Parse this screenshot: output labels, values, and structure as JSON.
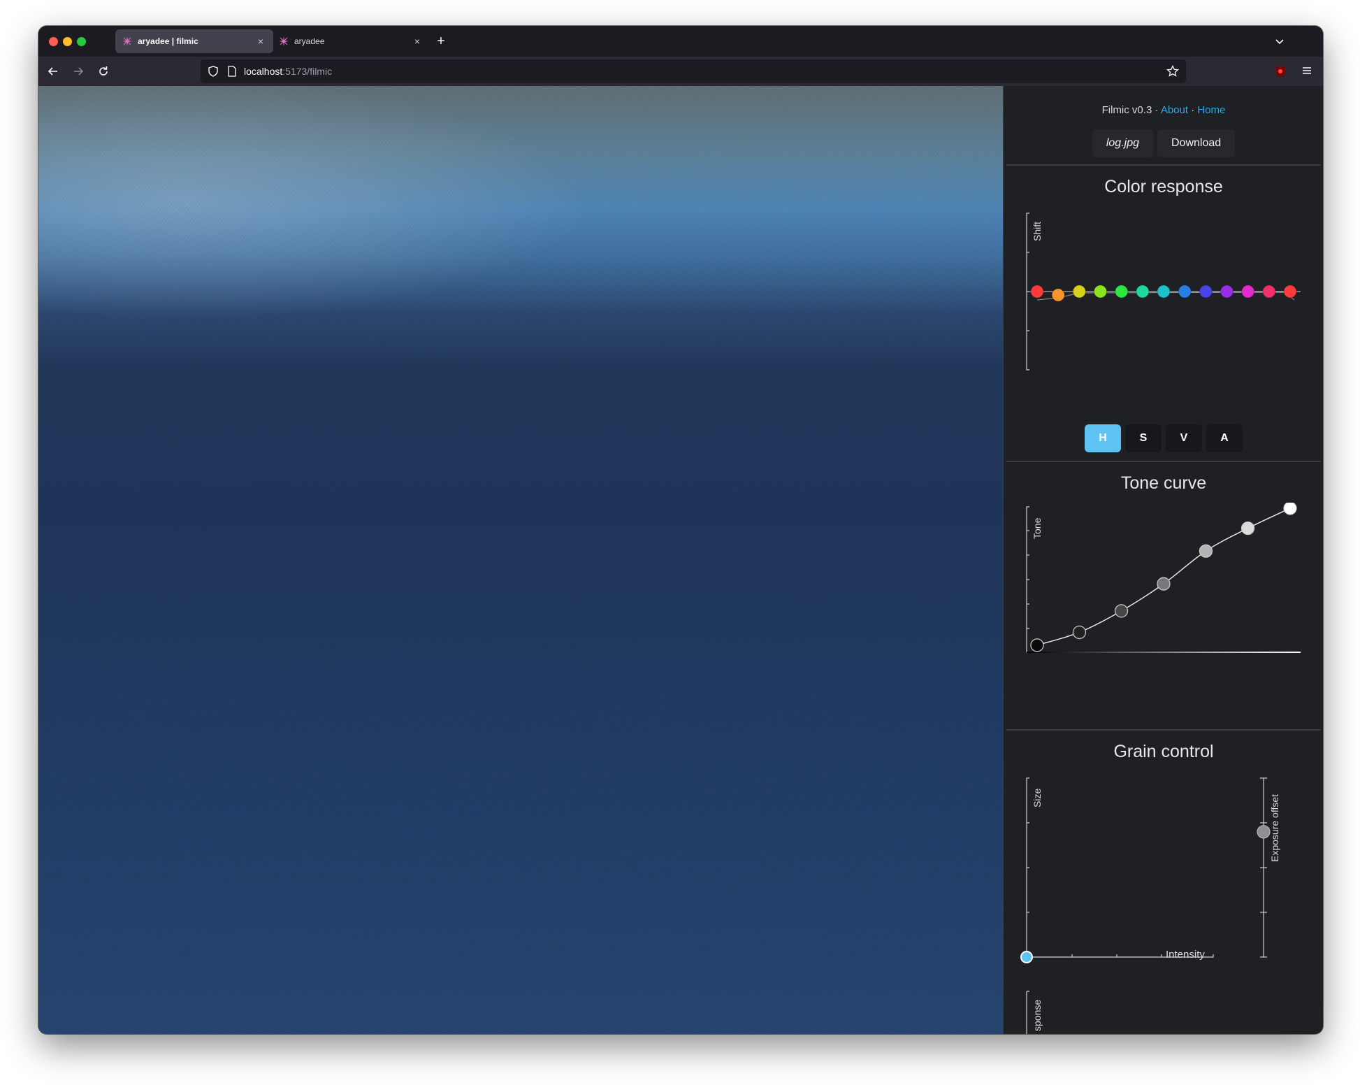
{
  "browser": {
    "tabs": [
      {
        "title": "aryadee | filmic",
        "close": "×"
      },
      {
        "title": "aryadee",
        "close": "×"
      }
    ],
    "new_tab": "+",
    "url_host": "localhost",
    "url_path": ":5173/filmic"
  },
  "panel": {
    "app_name": "Filmic v0.3",
    "sep1": "·",
    "about": "About",
    "sep2": "·",
    "home": "Home",
    "file_button": "log.jpg",
    "download_button": "Download",
    "accent": "#2fa7e6"
  },
  "color_response": {
    "title": "Color response",
    "y_label": "Shift",
    "modes": [
      "H",
      "S",
      "V",
      "A"
    ],
    "active_mode": "H",
    "points": [
      {
        "color": "#ff3b3b",
        "shift": 0.0
      },
      {
        "color": "#f7952a",
        "shift": -0.05
      },
      {
        "color": "#d6d11d",
        "shift": 0.0
      },
      {
        "color": "#8ee31f",
        "shift": 0.0
      },
      {
        "color": "#2ee542",
        "shift": 0.0
      },
      {
        "color": "#1fd89a",
        "shift": 0.0
      },
      {
        "color": "#1ec2c9",
        "shift": 0.0
      },
      {
        "color": "#2a7fe6",
        "shift": 0.0
      },
      {
        "color": "#4a44e8",
        "shift": 0.0
      },
      {
        "color": "#9a2ee6",
        "shift": 0.0
      },
      {
        "color": "#e22ccf",
        "shift": 0.0
      },
      {
        "color": "#f2306a",
        "shift": 0.0
      },
      {
        "color": "#ff3b3b",
        "shift": 0.0
      }
    ]
  },
  "tone_curve": {
    "title": "Tone curve",
    "y_label": "Tone",
    "points": [
      {
        "x": 0.0,
        "y": 0.04
      },
      {
        "x": 0.167,
        "y": 0.13
      },
      {
        "x": 0.333,
        "y": 0.28
      },
      {
        "x": 0.5,
        "y": 0.47
      },
      {
        "x": 0.667,
        "y": 0.7
      },
      {
        "x": 0.833,
        "y": 0.86
      },
      {
        "x": 1.0,
        "y": 1.0
      }
    ]
  },
  "grain_control": {
    "title": "Grain control",
    "y_label": "Size",
    "x_label": "Intensity",
    "slider_label": "Exposure offset",
    "size": 0.0,
    "intensity": 0.0,
    "exposure_offset": 0.7
  },
  "next_section": {
    "y_label": "sponse"
  }
}
